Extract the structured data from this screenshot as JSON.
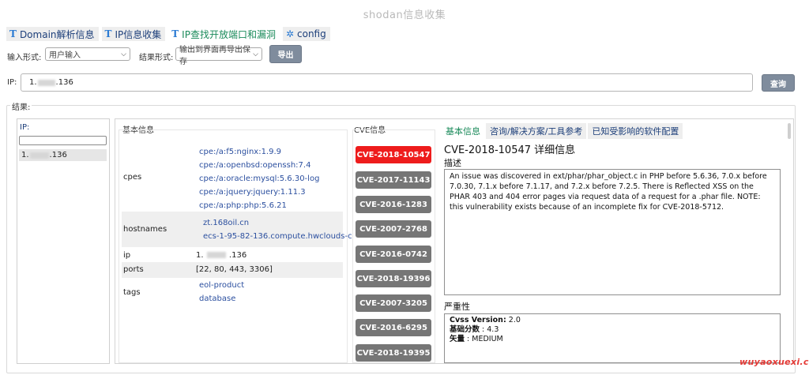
{
  "app": {
    "title": "shodan信息收集"
  },
  "tabs": [
    {
      "label": "Domain解析信息",
      "icon": "text-icon"
    },
    {
      "label": "IP信息收集",
      "icon": "text-icon"
    },
    {
      "label": "IP查找开放端口和漏洞",
      "icon": "text-icon"
    },
    {
      "label": "config",
      "icon": "gear-icon"
    }
  ],
  "controls": {
    "input_mode_label": "输入形式:",
    "input_mode_value": "用户输入",
    "result_mode_label": "结果形式:",
    "result_mode_value": "输出到界面再导出保存",
    "export_label": "导出"
  },
  "ip_bar": {
    "label": "IP:",
    "value_prefix": "1.",
    "value_suffix": ".136",
    "query_label": "查询"
  },
  "results": {
    "legend": "结果:",
    "ip_list": {
      "header": "IP:",
      "search_value": "",
      "items": [
        {
          "prefix": "1.",
          "suffix": ".136"
        }
      ]
    },
    "basic": {
      "legend": "基本信息",
      "cpes_key": "cpes",
      "cpes": [
        "cpe:/a:f5:nginx:1.9.9",
        "cpe:/a:openbsd:openssh:7.4",
        "cpe:/a:oracle:mysql:5.6.30-log",
        "cpe:/a:jquery:jquery:1.11.3",
        "cpe:/a:php:php:5.6.21"
      ],
      "hostnames_key": "hostnames",
      "hostnames": [
        "zt.168oil.cn",
        "ecs-1-95-82-136.compute.hwclouds-c"
      ],
      "ip_key": "ip",
      "ip_prefix": "1.",
      "ip_suffix": ".136",
      "ports_key": "ports",
      "ports_value": "[22, 80, 443, 3306]",
      "tags_key": "tags",
      "tags": [
        "eol-product",
        "database"
      ]
    },
    "cve": {
      "legend": "CVE信息",
      "items": [
        "CVE-2018-10547",
        "CVE-2017-11143",
        "CVE-2016-1283",
        "CVE-2007-2768",
        "CVE-2016-0742",
        "CVE-2018-19396",
        "CVE-2007-3205",
        "CVE-2016-6295",
        "CVE-2018-19395"
      ],
      "selected_index": 0,
      "active_color": "#ee1c1c"
    },
    "detail": {
      "tabs": [
        "基本信息",
        "咨询/解决方案/工具参考",
        "已知受影响的软件配置"
      ],
      "heading": "CVE-2018-10547 详细信息",
      "desc_label": "描述",
      "description": "An issue was discovered in ext/phar/phar_object.c in PHP before 5.6.36, 7.0.x before 7.0.30, 7.1.x before 7.1.17, and 7.2.x before 7.2.5. There is Reflected XSS on the PHAR 403 and 404 error pages via request data of a request for a .phar file. NOTE: this vulnerability exists because of an incomplete fix for CVE-2018-5712.",
      "severity_label": "严重性",
      "cvss_version_label": "Cvss Version:",
      "cvss_version": "2.0",
      "base_score_label": "基础分数",
      "base_score": "4.3",
      "vector_label": "矢量",
      "vector": "MEDIUM"
    }
  },
  "watermark": "wuyaoxuexi.cn"
}
